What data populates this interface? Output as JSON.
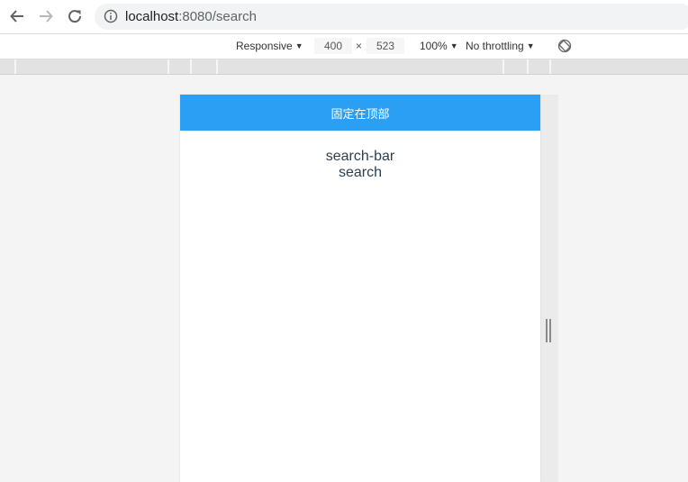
{
  "browser": {
    "url_host": "localhost",
    "url_path": ":8080/search",
    "back_icon": "arrow-left-icon",
    "forward_icon": "arrow-right-icon",
    "reload_icon": "reload-icon",
    "info_icon": "info-icon"
  },
  "devtools": {
    "device_mode": "Responsive",
    "width": "400",
    "separator": "×",
    "height": "523",
    "zoom": "100%",
    "throttling": "No throttling",
    "rotate_icon": "rotate-icon"
  },
  "page": {
    "header_title": "固定在顶部",
    "component_name": "search-bar",
    "route_name": "search",
    "accent_color": "#2a9ff4"
  }
}
